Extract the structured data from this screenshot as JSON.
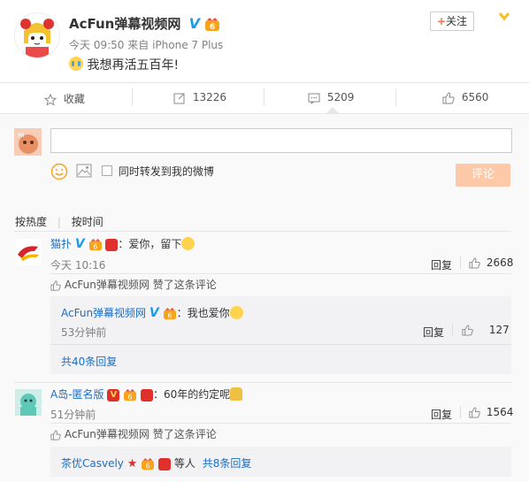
{
  "post": {
    "author": "AcFun弹幕视频网",
    "time": "今天 09:50",
    "source_prefix": "来自",
    "source": "iPhone 7 Plus",
    "content": "我想再活五百年!",
    "follow_label": "关注"
  },
  "actions": {
    "favorite": "收藏",
    "repost": "13226",
    "comment": "5209",
    "like": "6560"
  },
  "composer": {
    "forward_label": "同时转发到我的微博",
    "submit_label": "评论",
    "placeholder": ""
  },
  "sort": {
    "by_hot": "按热度",
    "by_time": "按时间"
  },
  "comments": [
    {
      "user": "猫扑",
      "text": "：爱你，留下",
      "time": "今天 10:16",
      "reply_label": "回复",
      "likes": "2668",
      "liked_by": "AcFun弹幕视频网",
      "liked_suffix": "赞了这条评论",
      "sub_user": "AcFun弹幕视频网",
      "sub_text": "：我也爱你",
      "sub_time": "53分钟前",
      "sub_reply_label": "回复",
      "sub_likes": "127",
      "more": "共40条回复"
    },
    {
      "user": "A岛-匿名版",
      "text": "：60年的约定呢",
      "time": "51分钟前",
      "reply_label": "回复",
      "likes": "1564",
      "liked_by": "AcFun弹幕视频网",
      "liked_suffix": "赞了这条评论",
      "sub_user": "茶优Casvely",
      "sub_text": "等人",
      "more": "共8条回复"
    }
  ],
  "colors": {
    "link": "#1b6ec2",
    "accent": "#eb7350",
    "submit_bg": "#fdc9a9",
    "bg_reply": "#f2f2f5"
  }
}
